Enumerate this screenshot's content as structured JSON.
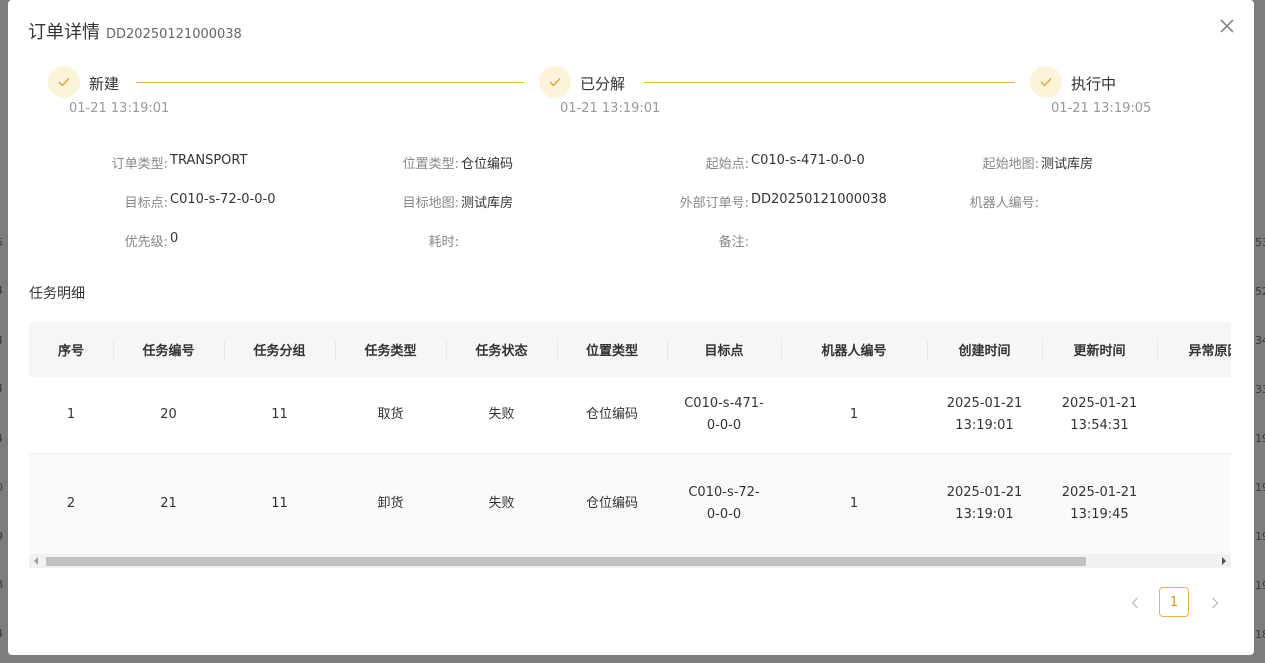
{
  "modal": {
    "title": "订单详情",
    "order_no": "DD20250121000038"
  },
  "steps": [
    {
      "label": "新建",
      "time": "01-21 13:19:01"
    },
    {
      "label": "已分解",
      "time": "01-21 13:19:01"
    },
    {
      "label": "执行中",
      "time": "01-21 13:19:05"
    }
  ],
  "info": {
    "order_type": {
      "label": "订单类型:",
      "value": "TRANSPORT"
    },
    "location_type": {
      "label": "位置类型:",
      "value": "仓位编码"
    },
    "start_point": {
      "label": "起始点:",
      "value": "C010-s-471-0-0-0"
    },
    "start_map": {
      "label": "起始地图:",
      "value": "测试库房"
    },
    "target_point": {
      "label": "目标点:",
      "value": "C010-s-72-0-0-0"
    },
    "target_map": {
      "label": "目标地图:",
      "value": "测试库房"
    },
    "external_order_no": {
      "label": "外部订单号:",
      "value": "DD20250121000038"
    },
    "robot_no": {
      "label": "机器人编号:",
      "value": ""
    },
    "priority": {
      "label": "优先级:",
      "value": "0"
    },
    "duration": {
      "label": "耗时:",
      "value": ""
    },
    "remark": {
      "label": "备注:",
      "value": ""
    }
  },
  "task_section_title": "任务明细",
  "table": {
    "headers": [
      "序号",
      "任务编号",
      "任务分组",
      "任务类型",
      "任务状态",
      "位置类型",
      "目标点",
      "机器人编号",
      "创建时间",
      "更新时间",
      "异常原因"
    ],
    "rows": [
      {
        "seq": "1",
        "task_no": "20",
        "group": "11",
        "type": "取货",
        "status": "失败",
        "location_type": "仓位编码",
        "target_line1": "C010-s-471-",
        "target_line2": "0-0-0",
        "robot": "1",
        "created_date": "2025-01-21",
        "created_time": "13:19:01",
        "updated_date": "2025-01-21",
        "updated_time": "13:54:31",
        "error": ""
      },
      {
        "seq": "2",
        "task_no": "21",
        "group": "11",
        "type": "卸货",
        "status": "失败",
        "location_type": "仓位编码",
        "target_line1": "C010-s-72-",
        "target_line2": "0-0-0",
        "robot": "1",
        "created_date": "2025-01-21",
        "created_time": "13:19:01",
        "updated_date": "2025-01-21",
        "updated_time": "13:19:45",
        "error": ""
      }
    ]
  },
  "pagination": {
    "current": "1"
  },
  "background": {
    "left_fragments": [
      "5",
      "4",
      "4",
      "4",
      "4",
      "4",
      "0",
      "9",
      "8",
      "4"
    ],
    "right_fragments": [
      "53",
      "52",
      "34",
      "33",
      "19",
      "19",
      "19",
      "19",
      "19",
      "18"
    ]
  },
  "colors": {
    "accent": "#e7b54a",
    "step_circle_bg": "#fdf3d9"
  }
}
